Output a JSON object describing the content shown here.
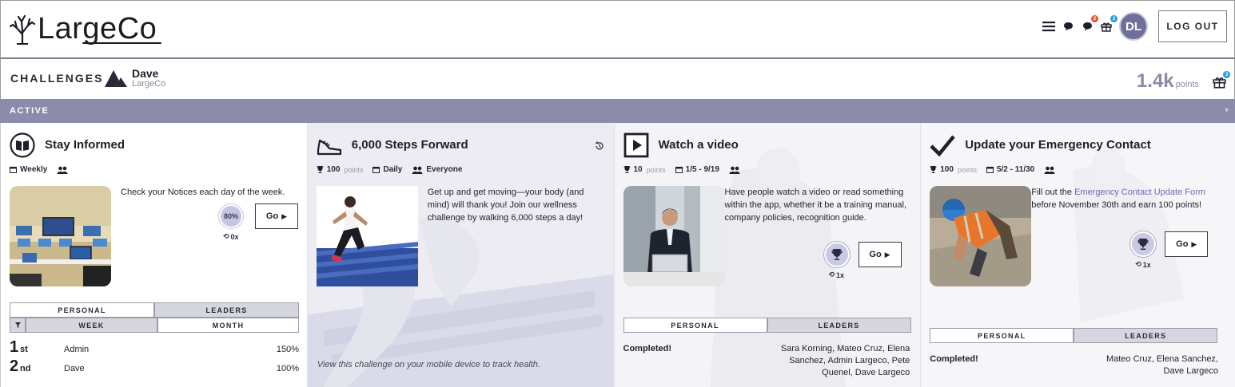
{
  "header": {
    "logo_text": "LargeCo",
    "logout_label": "LOG OUT",
    "avatar_initials": "DL",
    "notif_badges": [
      "2",
      "3"
    ],
    "icons": [
      "menu-icon",
      "chat-icon",
      "notifications-icon",
      "gift-icon"
    ],
    "badge_colors": {
      "red": "#e0573c",
      "blue": "#2e9bd6"
    }
  },
  "subheader": {
    "title": "CHALLENGES",
    "user_name": "Dave",
    "user_org": "LargeCo",
    "points_value": "1.4k",
    "points_unit": "points",
    "gift_badge": "3"
  },
  "section": {
    "label": "ACTIVE"
  },
  "colors": {
    "strip": "#8b8cab",
    "accent_link": "#6a6ab8",
    "progress": "#c6c6e3"
  },
  "cards": [
    {
      "title": "Stay Informed",
      "icon": "book-icon",
      "frequency": "Weekly",
      "description": "Check your Notices each day of the week.",
      "progress": "80%",
      "count": "0x",
      "go_label": "Go",
      "tabs": [
        "PERSONAL",
        "LEADERS"
      ],
      "subtabs": [
        "WEEK",
        "MONTH"
      ],
      "leaders": [
        {
          "rank": "1",
          "suffix": "st",
          "name": "Admin",
          "value": "150%"
        },
        {
          "rank": "2",
          "suffix": "nd",
          "name": "Dave",
          "value": "100%"
        }
      ]
    },
    {
      "title": "6,000 Steps Forward",
      "icon": "sneaker-icon",
      "points": "100",
      "points_unit": "points",
      "frequency": "Daily",
      "audience": "Everyone",
      "description": "Get up and get moving—your body (and mind) will thank you! Join our wellness challenge by walking 6,000 steps a day!",
      "mobile_note": "View this challenge on your mobile device to track health."
    },
    {
      "title": "Watch a video",
      "icon": "play-icon",
      "points": "10",
      "points_unit": "points",
      "dates": "1/5 - 9/19",
      "description": "Have people watch a video or read something within the app, whether it be a training manual, company policies, recognition guide.",
      "count": "1x",
      "go_label": "Go",
      "tabs": [
        "PERSONAL",
        "LEADERS"
      ],
      "completed_label": "Completed!",
      "completed_names": [
        "Sara Korning, Mateo Cruz, Elena",
        "Sanchez, Admin Largeco, Pete",
        "Quenel, Dave Largeco"
      ]
    },
    {
      "title": "Update your Emergency Contact",
      "icon": "checkmark-icon",
      "points": "100",
      "points_unit": "points",
      "dates": "5/2 - 11/30",
      "description_pre": "Fill out the ",
      "description_link": "Emergency Contact Update Form",
      "description_post": " before November 30th and earn 100 points!",
      "count": "1x",
      "go_label": "Go",
      "tabs": [
        "PERSONAL",
        "LEADERS"
      ],
      "completed_label": "Completed!",
      "completed_names": [
        "Mateo Cruz, Elena Sanchez,",
        "Dave Largeco"
      ]
    }
  ]
}
